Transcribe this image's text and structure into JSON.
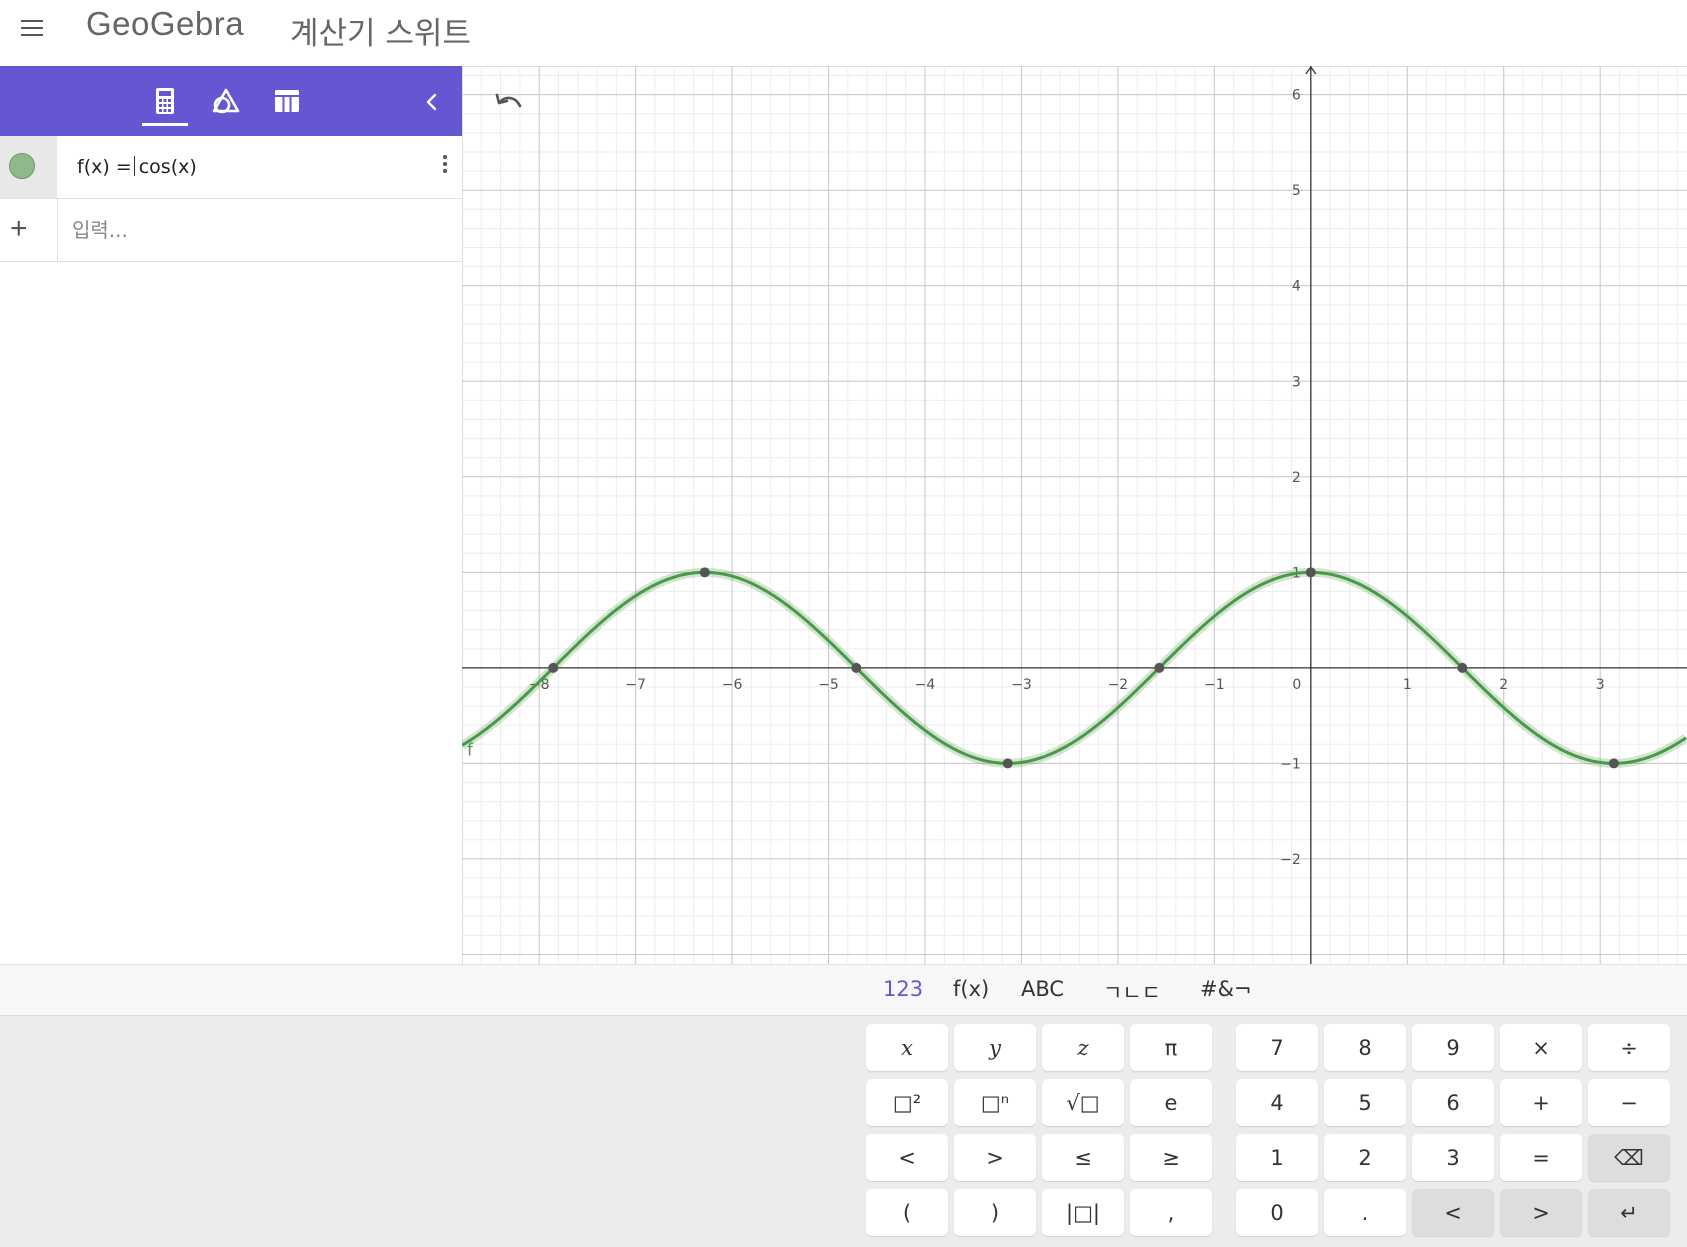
{
  "header": {
    "logo_text": "GeoGebra",
    "app_title": "계산기 스위트"
  },
  "algebra": {
    "tabs": [
      "algebra-calculator-icon",
      "geometry-icon",
      "table-icon"
    ],
    "active_tab": "algebra-calculator-icon",
    "rows": [
      {
        "lhs": "f(x) =",
        "rhs": "cos(x)",
        "color": "#8fb98c"
      }
    ],
    "input_placeholder": "입력..."
  },
  "graph": {
    "curve_label": "f",
    "curve_color": "#4a9948",
    "x_ticks": [
      "−8",
      "−7",
      "−6",
      "−5",
      "−4",
      "−3",
      "−2",
      "−1",
      "0",
      "1",
      "2",
      "3"
    ],
    "y_ticks": [
      "6",
      "5",
      "4",
      "3",
      "2",
      "1",
      "−1",
      "−2"
    ]
  },
  "chart_data": {
    "type": "line",
    "title": "",
    "function": "cos(x)",
    "series": [
      {
        "name": "f",
        "function": "cos(x)",
        "color": "#4a9948"
      }
    ],
    "special_points": [
      {
        "x": -7.854,
        "y": 0
      },
      {
        "x": -6.283,
        "y": 1
      },
      {
        "x": -4.712,
        "y": 0
      },
      {
        "x": -3.142,
        "y": -1
      },
      {
        "x": -1.571,
        "y": 0
      },
      {
        "x": 0,
        "y": 1
      },
      {
        "x": 1.571,
        "y": 0
      },
      {
        "x": 3.142,
        "y": -1
      }
    ],
    "xlim": [
      -8.8,
      3.9
    ],
    "ylim": [
      -3.1,
      6.3
    ],
    "grid": true,
    "xlabel": "",
    "ylabel": ""
  },
  "keyboard": {
    "tabs": [
      "123",
      "f(x)",
      "ABC",
      "ㄱㄴㄷ",
      "#&¬"
    ],
    "active_tab": "123",
    "left_keys": [
      [
        "x",
        "y",
        "z",
        "π"
      ],
      [
        "□²",
        "□ⁿ",
        "√□",
        "e"
      ],
      [
        "<",
        ">",
        "≤",
        "≥"
      ],
      [
        "(",
        ")",
        "|□|",
        ","
      ]
    ],
    "right_keys": [
      [
        "7",
        "8",
        "9",
        "×",
        "÷"
      ],
      [
        "4",
        "5",
        "6",
        "+",
        "−"
      ],
      [
        "1",
        "2",
        "3",
        "=",
        "⌫"
      ],
      [
        "0",
        ".",
        "<",
        ">",
        "↵"
      ]
    ]
  }
}
